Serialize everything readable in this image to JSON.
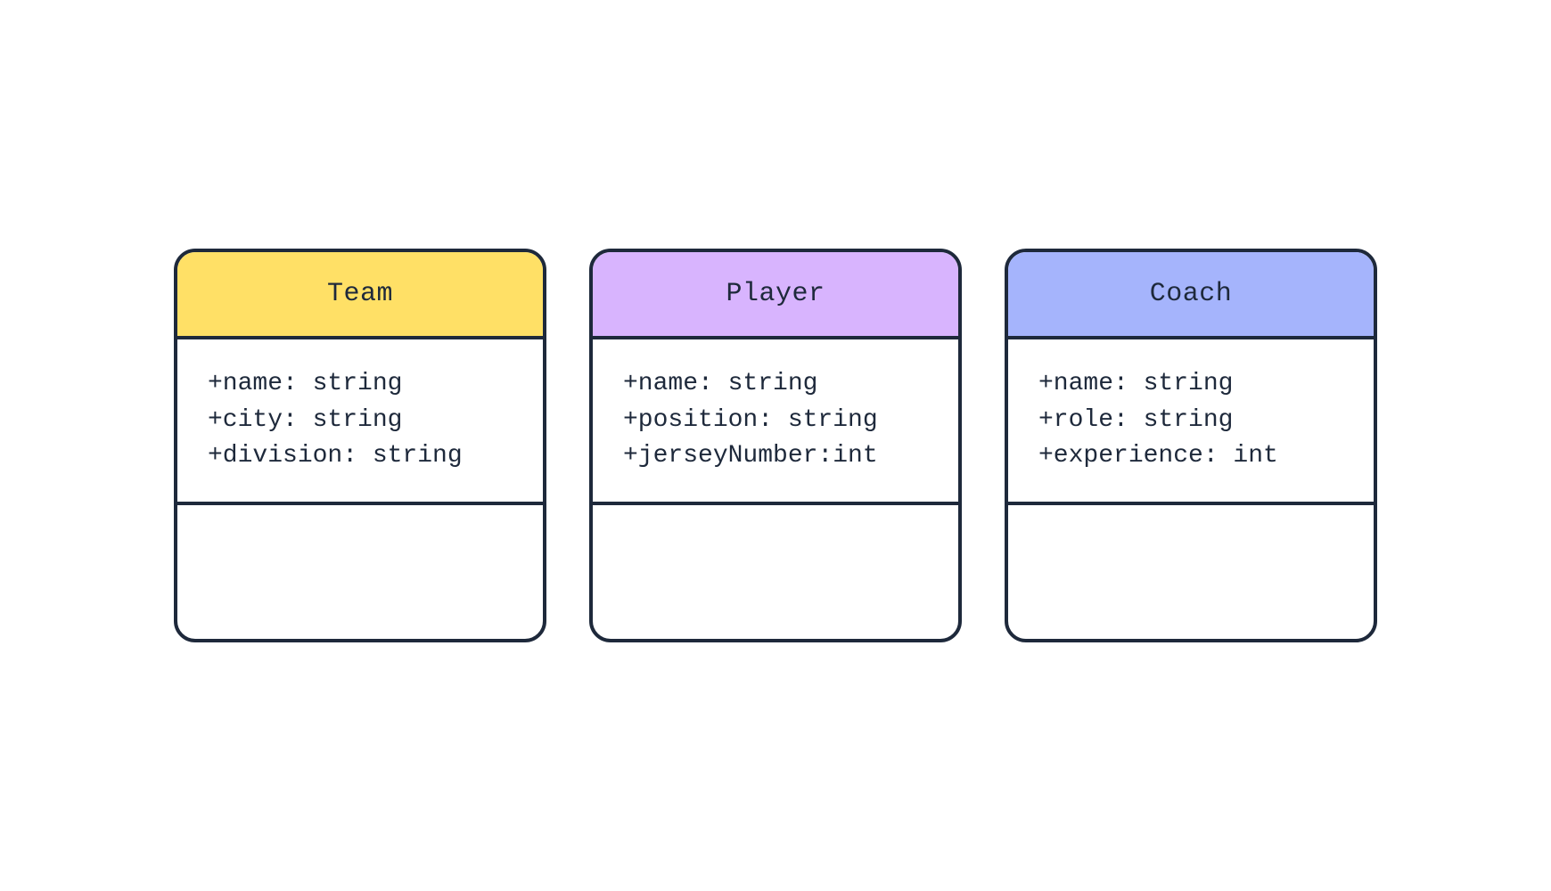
{
  "classes": [
    {
      "name": "Team",
      "headerColor": "yellow",
      "attributes": [
        "+name: string",
        "+city: string",
        "+division: string"
      ]
    },
    {
      "name": "Player",
      "headerColor": "purple",
      "attributes": [
        "+name: string",
        "+position: string",
        "+jerseyNumber:int"
      ]
    },
    {
      "name": "Coach",
      "headerColor": "blue",
      "attributes": [
        "+name: string",
        "+role: string",
        "+experience: int"
      ]
    }
  ]
}
